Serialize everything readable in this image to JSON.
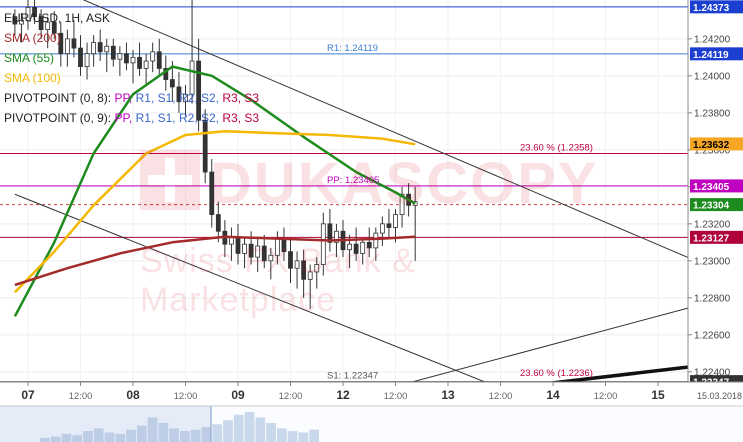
{
  "header": {
    "symbol": "EUR/USD, 1H, ASK",
    "indicators": [
      {
        "label": "SMA (200)",
        "color": "#a52a2a"
      },
      {
        "label": "SMA (55)",
        "color": "#1e8b1e"
      },
      {
        "label": "SMA (100)",
        "color": "#f5b800"
      }
    ],
    "pivot_rows": [
      {
        "prefix": "PIVOTPOINT (0, 8):",
        "items": [
          {
            "t": "PP,",
            "c": "#c000c0"
          },
          {
            "t": "R1,",
            "c": "#3a66cc"
          },
          {
            "t": "S1,",
            "c": "#3a66cc"
          },
          {
            "t": "R2,",
            "c": "#3a66cc"
          },
          {
            "t": "S2,",
            "c": "#3a66cc"
          },
          {
            "t": "R3,",
            "c": "#c00040"
          },
          {
            "t": "S3",
            "c": "#c00040"
          }
        ]
      },
      {
        "prefix": "PIVOTPOINT (0, 9):",
        "items": [
          {
            "t": "PP,",
            "c": "#c000c0"
          },
          {
            "t": "R1,",
            "c": "#3a66cc"
          },
          {
            "t": "S1,",
            "c": "#3a66cc"
          },
          {
            "t": "R2,",
            "c": "#3a66cc"
          },
          {
            "t": "S2,",
            "c": "#3a66cc"
          },
          {
            "t": "R3,",
            "c": "#c00040"
          },
          {
            "t": "S3",
            "c": "#c00040"
          }
        ]
      }
    ]
  },
  "watermark": {
    "title": "DUKASCOPY",
    "subtitle": "Swiss FX Bank & Marketplace"
  },
  "chart_data": {
    "type": "line",
    "title": "EUR/USD, 1H, ASK",
    "y_range": [
      1.22345,
      1.2441
    ],
    "y_ticks": [
      {
        "v": 1.242,
        "l": "1.24200"
      },
      {
        "v": 1.24,
        "l": "1.24000"
      },
      {
        "v": 1.238,
        "l": "1.23800"
      },
      {
        "v": 1.236,
        "l": "1.23600"
      },
      {
        "v": 1.234,
        "l": "1.23400"
      },
      {
        "v": 1.232,
        "l": "1.23200"
      },
      {
        "v": 1.23,
        "l": "1.23000"
      },
      {
        "v": 1.228,
        "l": "1.22800"
      },
      {
        "v": 1.226,
        "l": "1.22600"
      },
      {
        "v": 1.224,
        "l": "1.22400"
      }
    ],
    "x_range": [
      0,
      17.5
    ],
    "x_ticks": [
      {
        "t": 0.5,
        "l": "07",
        "major": true
      },
      {
        "t": 2.5,
        "l": "12:00",
        "major": false
      },
      {
        "t": 4.5,
        "l": "08",
        "major": true
      },
      {
        "t": 6.5,
        "l": "12:00",
        "major": false
      },
      {
        "t": 8.5,
        "l": "09",
        "major": true
      },
      {
        "t": 10.5,
        "l": "12:00",
        "major": false
      },
      {
        "t": 12.5,
        "l": "12",
        "major": true
      },
      {
        "t": 14.5,
        "l": "12:00",
        "major": false
      },
      {
        "t": 16.5,
        "l": "13",
        "major": true
      },
      {
        "t": 18.5,
        "l": "12:00",
        "major": false
      },
      {
        "t": 20.5,
        "l": "14",
        "major": true
      },
      {
        "t": 22.5,
        "l": "12:00",
        "major": false
      },
      {
        "t": 24.5,
        "l": "15",
        "major": true
      }
    ],
    "date_label": "15.03.2018",
    "price_badges": [
      {
        "v": 1.24373,
        "l": "1.24373",
        "bg": "#1c3fd1",
        "fg": "#ffffff"
      },
      {
        "v": 1.24119,
        "l": "1.24119",
        "bg": "#1c3fd1",
        "fg": "#ffffff"
      },
      {
        "v": 1.23632,
        "l": "1.23632",
        "bg": "#f5a623",
        "fg": "#000000"
      },
      {
        "v": 1.23405,
        "l": "1.23405",
        "bg": "#c000c0",
        "fg": "#ffffff"
      },
      {
        "v": 1.23304,
        "l": "1.23304",
        "bg": "#1e8b1e",
        "fg": "#ffffff"
      },
      {
        "v": 1.23127,
        "l": "1.23127",
        "bg": "#b0003a",
        "fg": "#ffffff"
      },
      {
        "v": 1.22347,
        "l": "1.22347",
        "bg": "#333333",
        "fg": "#ffffff"
      }
    ],
    "level_labels": [
      {
        "v": 1.24119,
        "l": "R1: 1.24119",
        "color": "#3a7fd0",
        "side": "left"
      },
      {
        "v": 1.2358,
        "l": "23.60 % (1.2358)",
        "color": "#c00040",
        "side": "right"
      },
      {
        "v": 1.23405,
        "l": "PP: 1.23405",
        "color": "#c000c0",
        "side": "left"
      },
      {
        "v": 1.22347,
        "l": "S1: 1.22347",
        "color": "#555555",
        "side": "left"
      },
      {
        "v": 1.2236,
        "l": "23.60 % (1.2236)",
        "color": "#c00040",
        "side": "right"
      }
    ],
    "candles": [
      [
        0.0,
        1.2432,
        1.2436,
        1.2422,
        1.2428
      ],
      [
        0.25,
        1.2428,
        1.2434,
        1.2418,
        1.243
      ],
      [
        0.5,
        1.243,
        1.2441,
        1.2425,
        1.2437
      ],
      [
        0.75,
        1.2437,
        1.2441,
        1.2428,
        1.2432
      ],
      [
        1.0,
        1.2432,
        1.2436,
        1.242,
        1.2425
      ],
      [
        1.25,
        1.2425,
        1.2432,
        1.2415,
        1.2429
      ],
      [
        1.5,
        1.2429,
        1.2435,
        1.242,
        1.2423
      ],
      [
        1.75,
        1.2423,
        1.2429,
        1.2405,
        1.2412
      ],
      [
        2.0,
        1.2412,
        1.2425,
        1.2405,
        1.242
      ],
      [
        2.25,
        1.242,
        1.243,
        1.241,
        1.2415
      ],
      [
        2.5,
        1.2415,
        1.2422,
        1.24,
        1.2405
      ],
      [
        2.75,
        1.2405,
        1.2418,
        1.2398,
        1.2412
      ],
      [
        3.0,
        1.2412,
        1.2422,
        1.2405,
        1.2418
      ],
      [
        3.25,
        1.2418,
        1.2425,
        1.2408,
        1.2413
      ],
      [
        3.5,
        1.2413,
        1.242,
        1.2402,
        1.2416
      ],
      [
        3.75,
        1.2416,
        1.242,
        1.2405,
        1.2409
      ],
      [
        4.0,
        1.2409,
        1.2416,
        1.24,
        1.2412
      ],
      [
        4.25,
        1.2412,
        1.2418,
        1.2403,
        1.2407
      ],
      [
        4.5,
        1.2407,
        1.2414,
        1.2396,
        1.241
      ],
      [
        4.75,
        1.241,
        1.2418,
        1.24,
        1.2404
      ],
      [
        5.0,
        1.2404,
        1.2412,
        1.2395,
        1.2408
      ],
      [
        5.25,
        1.2408,
        1.2418,
        1.2402,
        1.2413
      ],
      [
        5.5,
        1.2413,
        1.242,
        1.24,
        1.2404
      ],
      [
        5.75,
        1.2404,
        1.2411,
        1.2392,
        1.2398
      ],
      [
        6.0,
        1.2398,
        1.2408,
        1.2386,
        1.2394
      ],
      [
        6.25,
        1.2394,
        1.2402,
        1.238,
        1.2386
      ],
      [
        6.5,
        1.2386,
        1.2395,
        1.2378,
        1.239
      ],
      [
        6.75,
        1.239,
        1.2441,
        1.2385,
        1.2408
      ],
      [
        7.0,
        1.2408,
        1.242,
        1.237,
        1.2376
      ],
      [
        7.25,
        1.2376,
        1.2382,
        1.2342,
        1.2348
      ],
      [
        7.5,
        1.2348,
        1.2355,
        1.2318,
        1.2325
      ],
      [
        7.75,
        1.2325,
        1.2332,
        1.231,
        1.2316
      ],
      [
        8.0,
        1.2316,
        1.2322,
        1.2302,
        1.2309
      ],
      [
        8.25,
        1.2309,
        1.2318,
        1.23,
        1.2313
      ],
      [
        8.5,
        1.2313,
        1.232,
        1.2298,
        1.2304
      ],
      [
        8.75,
        1.2304,
        1.2312,
        1.2296,
        1.2309
      ],
      [
        9.0,
        1.2309,
        1.2316,
        1.2298,
        1.2302
      ],
      [
        9.25,
        1.2302,
        1.2313,
        1.2294,
        1.2308
      ],
      [
        9.5,
        1.2308,
        1.2314,
        1.2296,
        1.23
      ],
      [
        9.75,
        1.23,
        1.2307,
        1.229,
        1.2303
      ],
      [
        10.0,
        1.2303,
        1.2316,
        1.2298,
        1.2312
      ],
      [
        10.25,
        1.2312,
        1.2318,
        1.23,
        1.2305
      ],
      [
        10.5,
        1.2305,
        1.2312,
        1.2288,
        1.2296
      ],
      [
        10.75,
        1.2296,
        1.2305,
        1.2285,
        1.23
      ],
      [
        11.0,
        1.23,
        1.2306,
        1.228,
        1.229
      ],
      [
        11.25,
        1.229,
        1.2298,
        1.2274,
        1.2294
      ],
      [
        11.5,
        1.2294,
        1.2302,
        1.2285,
        1.2298
      ],
      [
        11.75,
        1.2298,
        1.2326,
        1.2292,
        1.232
      ],
      [
        12.0,
        1.232,
        1.2328,
        1.2305,
        1.231
      ],
      [
        12.25,
        1.231,
        1.232,
        1.2302,
        1.2316
      ],
      [
        12.5,
        1.2316,
        1.2322,
        1.2302,
        1.2306
      ],
      [
        12.75,
        1.2306,
        1.2314,
        1.2296,
        1.2309
      ],
      [
        13.0,
        1.2309,
        1.2318,
        1.23,
        1.2304
      ],
      [
        13.25,
        1.2304,
        1.2312,
        1.2298,
        1.231
      ],
      [
        13.5,
        1.231,
        1.2318,
        1.2302,
        1.2307
      ],
      [
        13.75,
        1.2307,
        1.2318,
        1.23,
        1.2315
      ],
      [
        14.0,
        1.2315,
        1.2324,
        1.2308,
        1.232
      ],
      [
        14.25,
        1.232,
        1.2328,
        1.2312,
        1.2318
      ],
      [
        14.5,
        1.2318,
        1.2328,
        1.231,
        1.2325
      ],
      [
        14.75,
        1.2325,
        1.234,
        1.2318,
        1.2336
      ],
      [
        15.0,
        1.2336,
        1.2342,
        1.2324,
        1.233
      ],
      [
        15.25,
        1.233,
        1.234,
        1.23,
        1.2332
      ]
    ],
    "series": [
      {
        "name": "SMA (55)",
        "color": "#1e8b1e",
        "width": 2.5,
        "points": [
          [
            0,
            1.227
          ],
          [
            1.5,
            1.231
          ],
          [
            3,
            1.2358
          ],
          [
            4.5,
            1.239
          ],
          [
            6,
            1.2405
          ],
          [
            7.5,
            1.24
          ],
          [
            9,
            1.2387
          ],
          [
            11,
            1.2367
          ],
          [
            13,
            1.2348
          ],
          [
            14.5,
            1.2337
          ],
          [
            15.25,
            1.2331
          ]
        ]
      },
      {
        "name": "SMA (100)",
        "color": "#f5b800",
        "width": 2.5,
        "points": [
          [
            0,
            1.2283
          ],
          [
            1.5,
            1.2305
          ],
          [
            3,
            1.233
          ],
          [
            5,
            1.2358
          ],
          [
            6.5,
            1.2368
          ],
          [
            8,
            1.237
          ],
          [
            10,
            1.2369
          ],
          [
            12,
            1.2368
          ],
          [
            14,
            1.2366
          ],
          [
            15.25,
            1.2363
          ]
        ]
      },
      {
        "name": "SMA (200)",
        "color": "#a52a2a",
        "width": 2.5,
        "points": [
          [
            0,
            1.2287
          ],
          [
            2,
            1.2296
          ],
          [
            4,
            1.2304
          ],
          [
            6,
            1.231
          ],
          [
            8,
            1.2313
          ],
          [
            10,
            1.2312
          ],
          [
            12,
            1.2311
          ],
          [
            14,
            1.2312
          ],
          [
            15.25,
            1.2313
          ]
        ]
      }
    ],
    "trend_lines": [
      {
        "p1": [
          2.3,
          1.2443
        ],
        "p2": [
          27.1,
          1.2293
        ],
        "color": "#333333",
        "w": 1
      },
      {
        "p1": [
          0,
          1.2336
        ],
        "p2": [
          18.0,
          1.2234
        ],
        "color": "#333333",
        "w": 1
      },
      {
        "p1": [
          15.0,
          1.2234
        ],
        "p2": [
          27.1,
          1.228
        ],
        "color": "#333333",
        "w": 1
      },
      {
        "p1": [
          20.5,
          1.2234
        ],
        "p2": [
          27.1,
          1.2245
        ],
        "color": "#111111",
        "w": 3.5
      }
    ],
    "h_lines": [
      {
        "v": 1.24373,
        "color": "#1c3fd1",
        "w": 1,
        "dash": ""
      },
      {
        "v": 1.24119,
        "color": "#3a7fd0",
        "w": 1,
        "dash": ""
      },
      {
        "v": 1.2358,
        "color": "#c00040",
        "w": 1,
        "dash": ""
      },
      {
        "v": 1.23405,
        "color": "#c000c0",
        "w": 1,
        "dash": ""
      },
      {
        "v": 1.23304,
        "color": "#d04040",
        "w": 1,
        "dash": "3,3"
      },
      {
        "v": 1.23127,
        "color": "#b0003a",
        "w": 1,
        "dash": ""
      },
      {
        "v": 1.22347,
        "color": "#555555",
        "w": 1,
        "dash": ""
      }
    ],
    "volume_profile": [
      3,
      4,
      6,
      5,
      8,
      10,
      7,
      6,
      9,
      12,
      18,
      14,
      10,
      8,
      9,
      11,
      13,
      16,
      20,
      22,
      18,
      14,
      10,
      8,
      7,
      9
    ]
  }
}
